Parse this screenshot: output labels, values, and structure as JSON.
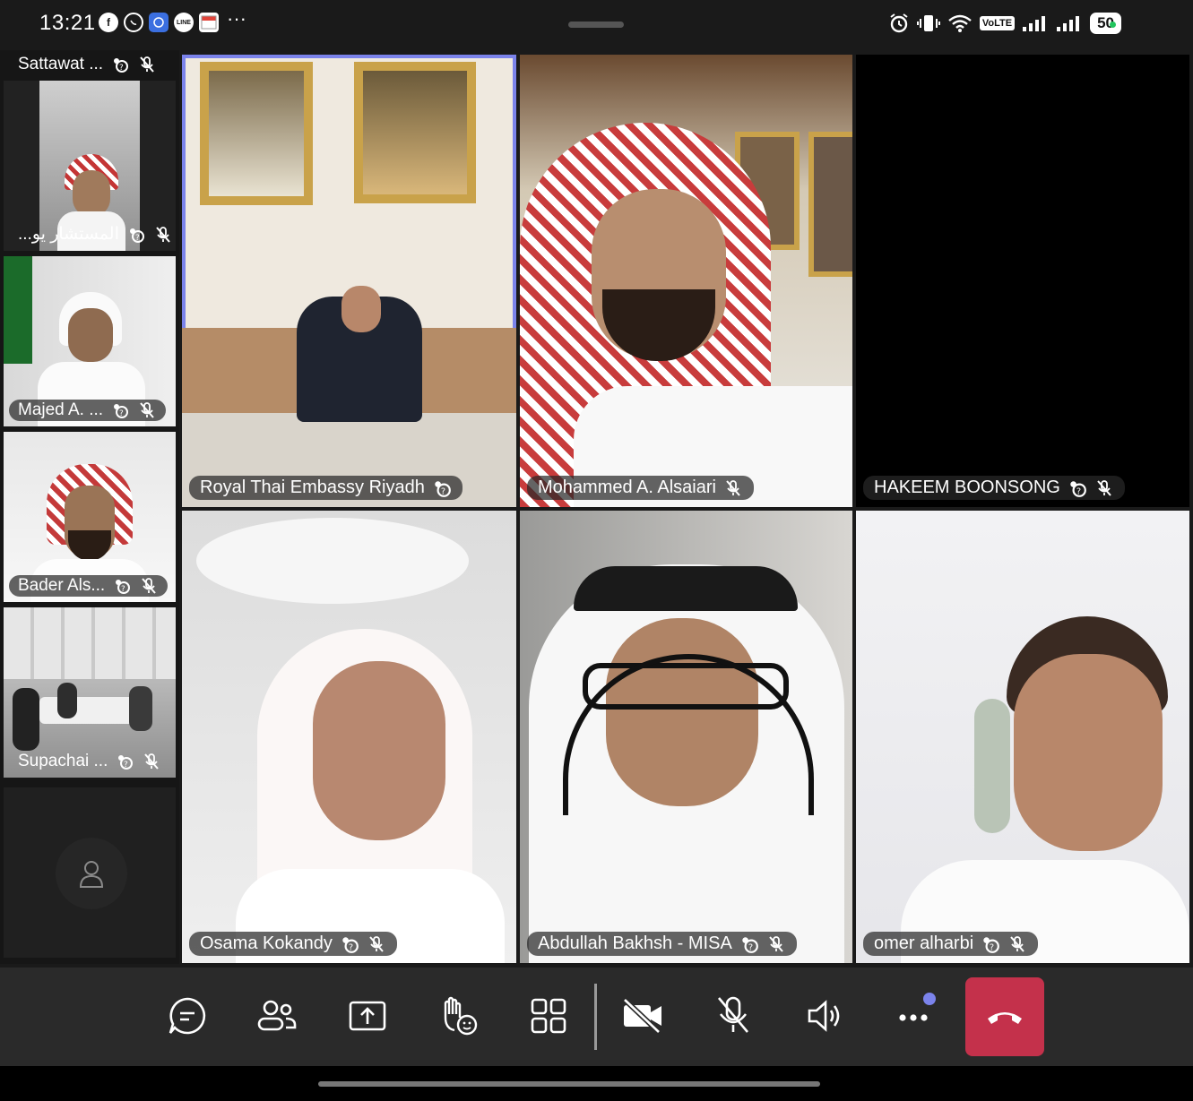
{
  "status_bar": {
    "time": "13:21",
    "more": "···",
    "network": "VoLTE",
    "battery": "50",
    "app_icons": [
      "facebook-icon",
      "whatsapp-icon",
      "ai-app-icon",
      "line-icon",
      "calendar-icon"
    ]
  },
  "sidebar": {
    "participants": [
      {
        "name": "Sattawat ..."
      },
      {
        "name": "المستشار يو..."
      },
      {
        "name": "Majed A. ..."
      },
      {
        "name": "Bader Als..."
      },
      {
        "name": "Supachai ..."
      }
    ]
  },
  "grid": {
    "participants": [
      {
        "name": "Royal Thai Embassy Riyadh",
        "active_speaker": true
      },
      {
        "name": "Mohammed A. Alsaiari"
      },
      {
        "name": "HAKEEM BOONSONG",
        "video_off": true
      },
      {
        "name": "Osama Kokandy"
      },
      {
        "name": "Abdullah Bakhsh - MISA"
      },
      {
        "name": "omer alharbi"
      }
    ]
  },
  "toolbar": {
    "buttons": [
      "chat",
      "people",
      "share",
      "react",
      "view",
      "camera",
      "mic",
      "speaker",
      "more",
      "leave"
    ],
    "accent": "#7b83eb",
    "leave_color": "#c4314b"
  }
}
